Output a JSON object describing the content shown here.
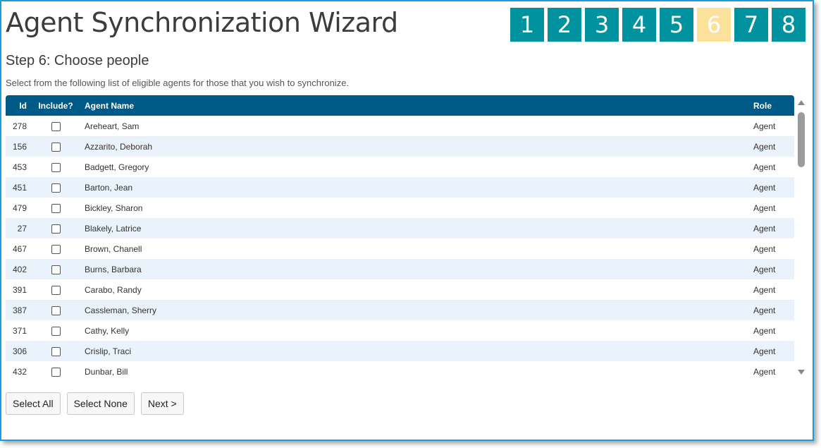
{
  "wizard": {
    "title": "Agent Synchronization Wizard",
    "steps": [
      "1",
      "2",
      "3",
      "4",
      "5",
      "6",
      "7",
      "8"
    ],
    "current_step": 6
  },
  "step": {
    "heading": "Step 6: Choose people",
    "description": "Select from the following list of eligible agents for those that you wish to synchronize."
  },
  "table": {
    "headers": {
      "id": "Id",
      "include": "Include?",
      "name": "Agent Name",
      "role": "Role"
    },
    "rows": [
      {
        "id": "278",
        "name": "Areheart, Sam",
        "role": "Agent",
        "included": false
      },
      {
        "id": "156",
        "name": "Azzarito, Deborah",
        "role": "Agent",
        "included": false
      },
      {
        "id": "453",
        "name": "Badgett, Gregory",
        "role": "Agent",
        "included": false
      },
      {
        "id": "451",
        "name": "Barton, Jean",
        "role": "Agent",
        "included": false
      },
      {
        "id": "479",
        "name": "Bickley, Sharon",
        "role": "Agent",
        "included": false
      },
      {
        "id": "27",
        "name": "Blakely, Latrice",
        "role": "Agent",
        "included": false
      },
      {
        "id": "467",
        "name": "Brown, Chanell",
        "role": "Agent",
        "included": false
      },
      {
        "id": "402",
        "name": "Burns, Barbara",
        "role": "Agent",
        "included": false
      },
      {
        "id": "391",
        "name": "Carabo, Randy",
        "role": "Agent",
        "included": false
      },
      {
        "id": "387",
        "name": "Cassleman, Sherry",
        "role": "Agent",
        "included": false
      },
      {
        "id": "371",
        "name": "Cathy, Kelly",
        "role": "Agent",
        "included": false
      },
      {
        "id": "306",
        "name": "Crislip, Traci",
        "role": "Agent",
        "included": false
      },
      {
        "id": "432",
        "name": "Dunbar, Bill",
        "role": "Agent",
        "included": false
      }
    ]
  },
  "buttons": {
    "select_all": "Select All",
    "select_none": "Select None",
    "next": "Next >"
  },
  "colors": {
    "step_active": "#00939f",
    "step_current": "#fce19a",
    "header_bg": "#005a87",
    "row_alt": "#eaf2fb",
    "frame_border": "#1e9ad6"
  }
}
